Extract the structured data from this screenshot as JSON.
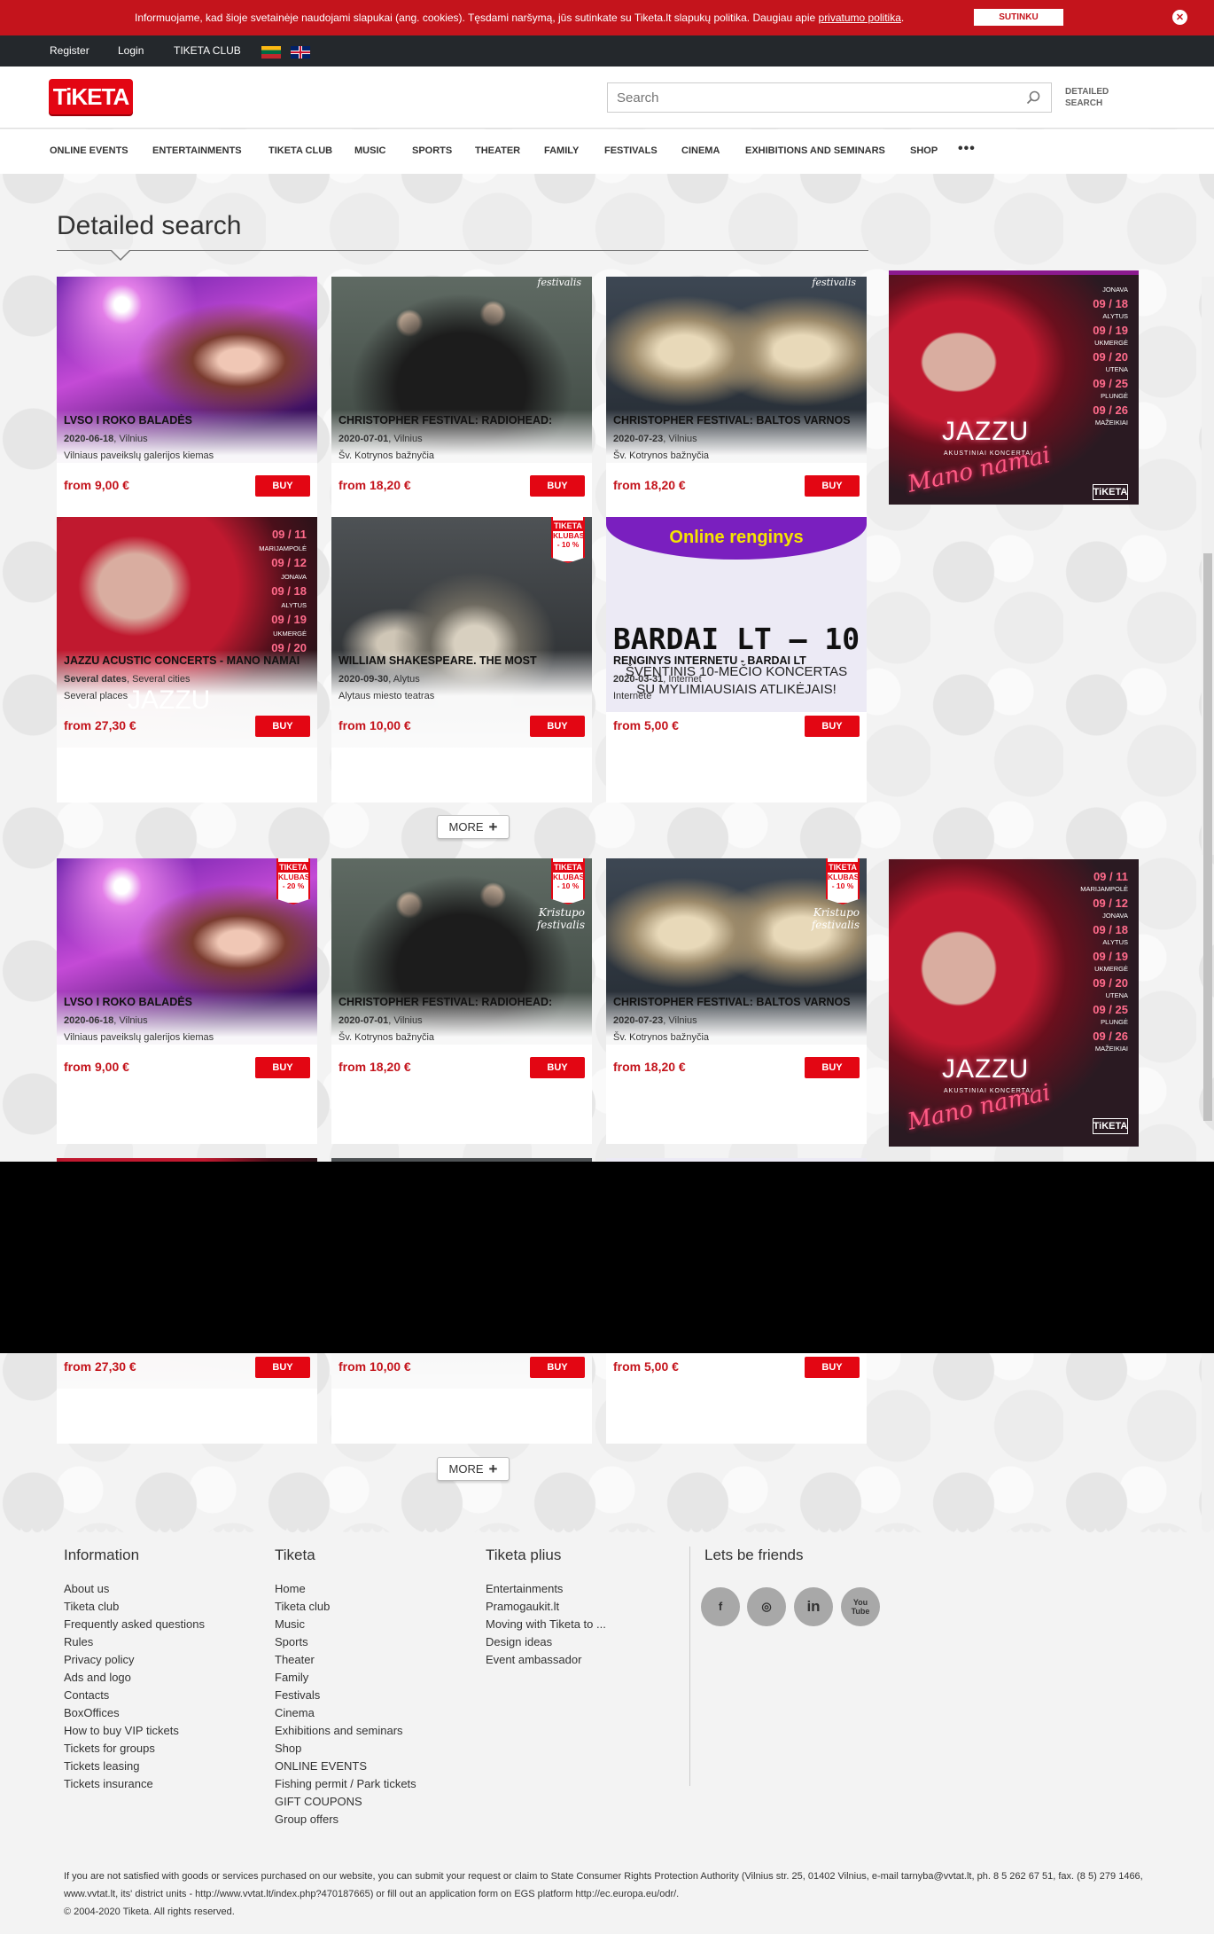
{
  "cookie": {
    "text": "Informuojame, kad šioje svetainėje naudojami slapukai (ang. cookies). Tęsdami naršymą, jūs sutinkate su Tiketa.lt slapukų politika. Daugiau apie ",
    "link": "privatumo politika",
    "accept": "SUTINKU",
    "close": "✕"
  },
  "topbar": {
    "register": "Register",
    "login": "Login",
    "club": "TIKETA CLUB"
  },
  "header": {
    "logo": "TiKETA",
    "search_placeholder": "Search",
    "detailed_line1": "DETAILED",
    "detailed_line2": "SEARCH"
  },
  "nav": [
    "ONLINE EVENTS",
    "ENTERTAINMENTS",
    "TIKETA CLUB",
    "MUSIC",
    "SPORTS",
    "THEATER",
    "FAMILY",
    "FESTIVALS",
    "CINEMA",
    "EXHIBITIONS AND SEMINARS",
    "SHOP"
  ],
  "nav_more": "•••",
  "page_title": "Detailed search",
  "more_label": "MORE",
  "cards": [
    {
      "name": "LVSO I ROKO BALADĖS",
      "date": "2020-06-18",
      "city": "Vilnius",
      "place": "Vilniaus paveikslų galerijos kiemas",
      "price": "from 9,00 €",
      "buy": "BUY"
    },
    {
      "name": "CHRISTOPHER FESTIVAL: RADIOHEAD:",
      "date": "2020-07-01",
      "city": "Vilnius",
      "place": "Šv. Kotrynos bažnyčia",
      "price": "from 18,20 €",
      "buy": "BUY"
    },
    {
      "name": "CHRISTOPHER FESTIVAL: BALTOS VARNOS",
      "date": "2020-07-23",
      "city": "Vilnius",
      "place": "Šv. Kotrynos bažnyčia",
      "price": "from 18,20 €",
      "buy": "BUY"
    },
    {
      "name": "JAZZU ACUSTIC CONCERTS - MANO NAMAI",
      "date": "Several dates",
      "city": "Several cities",
      "place": "Several places",
      "price": "from 27,30 €",
      "buy": "BUY"
    },
    {
      "name": "WILLIAM SHAKESPEARE. THE MOST",
      "date": "2020-09-30",
      "city": "Alytus",
      "place": "Alytaus miesto teatras",
      "price": "from 10,00 €",
      "buy": "BUY"
    },
    {
      "name": "RENGINYS INTERNETU - BARDAI LT",
      "date": "2020-03-31",
      "city": "Internet",
      "place": "Internete",
      "price": "from 5,00 €",
      "buy": "BUY"
    }
  ],
  "badge": {
    "top": "TIKETA",
    "line": "KLUBAS",
    "pct10": "- 10 %",
    "pct20": "- 20 %"
  },
  "online_banner": {
    "top": "Online renginys",
    "big": "BARDAI LT – 10",
    "l1": "ŠVENTINIS 10-MEČIO KONCERTAS",
    "l2": "SU MYLIMIAUSIAIS ATLIKĖJAIS!"
  },
  "poster_words": {
    "festivalis": "festivalis",
    "kristupo": "Kristupo"
  },
  "ad": {
    "brand": "JAZZU",
    "sub": "AKUSTINIAI KONCERTAI",
    "script": "Mano namai",
    "ticket": "TiKETA",
    "dates": [
      [
        "09 / 11",
        "MARIJAMPOLĖ"
      ],
      [
        "09 / 12",
        "JONAVA"
      ],
      [
        "09 / 18",
        "ALYTUS"
      ],
      [
        "09 / 19",
        "UKMERGĖ"
      ],
      [
        "09 / 20",
        "UTENA"
      ],
      [
        "09 / 25",
        "PLUNGĖ"
      ],
      [
        "09 / 26",
        "MAŽEIKIAI"
      ]
    ]
  },
  "footer": {
    "information": {
      "title": "Information",
      "items": [
        "About us",
        "Tiketa club",
        "Frequently asked questions",
        "Rules",
        "Privacy policy",
        "Ads and logo",
        "Contacts",
        "BoxOffices",
        "How to buy VIP tickets",
        "Tickets for groups",
        "Tickets leasing",
        "Tickets insurance"
      ]
    },
    "tiketa": {
      "title": "Tiketa",
      "items": [
        "Home",
        "Tiketa club",
        "Music",
        "Sports",
        "Theater",
        "Family",
        "Festivals",
        "Cinema",
        "Exhibitions and seminars",
        "Shop",
        "ONLINE EVENTS",
        "Fishing permit / Park tickets",
        "GIFT COUPONS",
        "Group offers"
      ]
    },
    "plius": {
      "title": "Tiketa plius",
      "items": [
        "Entertainments",
        "Pramogaukit.lt",
        "Moving with Tiketa to ...",
        "Design ideas",
        "Event ambassador"
      ]
    },
    "friends": {
      "title": "Lets be friends",
      "facebook": "f",
      "instagram": "◎",
      "linkedin": "in",
      "youtube": "You Tube"
    },
    "legal": "If you are not satisfied with goods or services purchased on our website, you can submit your request or claim to State Consumer Rights Protection Authority (Vilnius str. 25, 01402 Vilnius, e-mail tarnyba@vvtat.lt, ph. 8 5 262 67 51, fax. (8 5) 279 1466, www.vvtat.lt, its' district units - http://www.vvtat.lt/index.php?470187665) or fill out an application form on EGS platform http://ec.europa.eu/odr/.",
    "copyright": "© 2004-2020 Tiketa. All rights reserved."
  }
}
